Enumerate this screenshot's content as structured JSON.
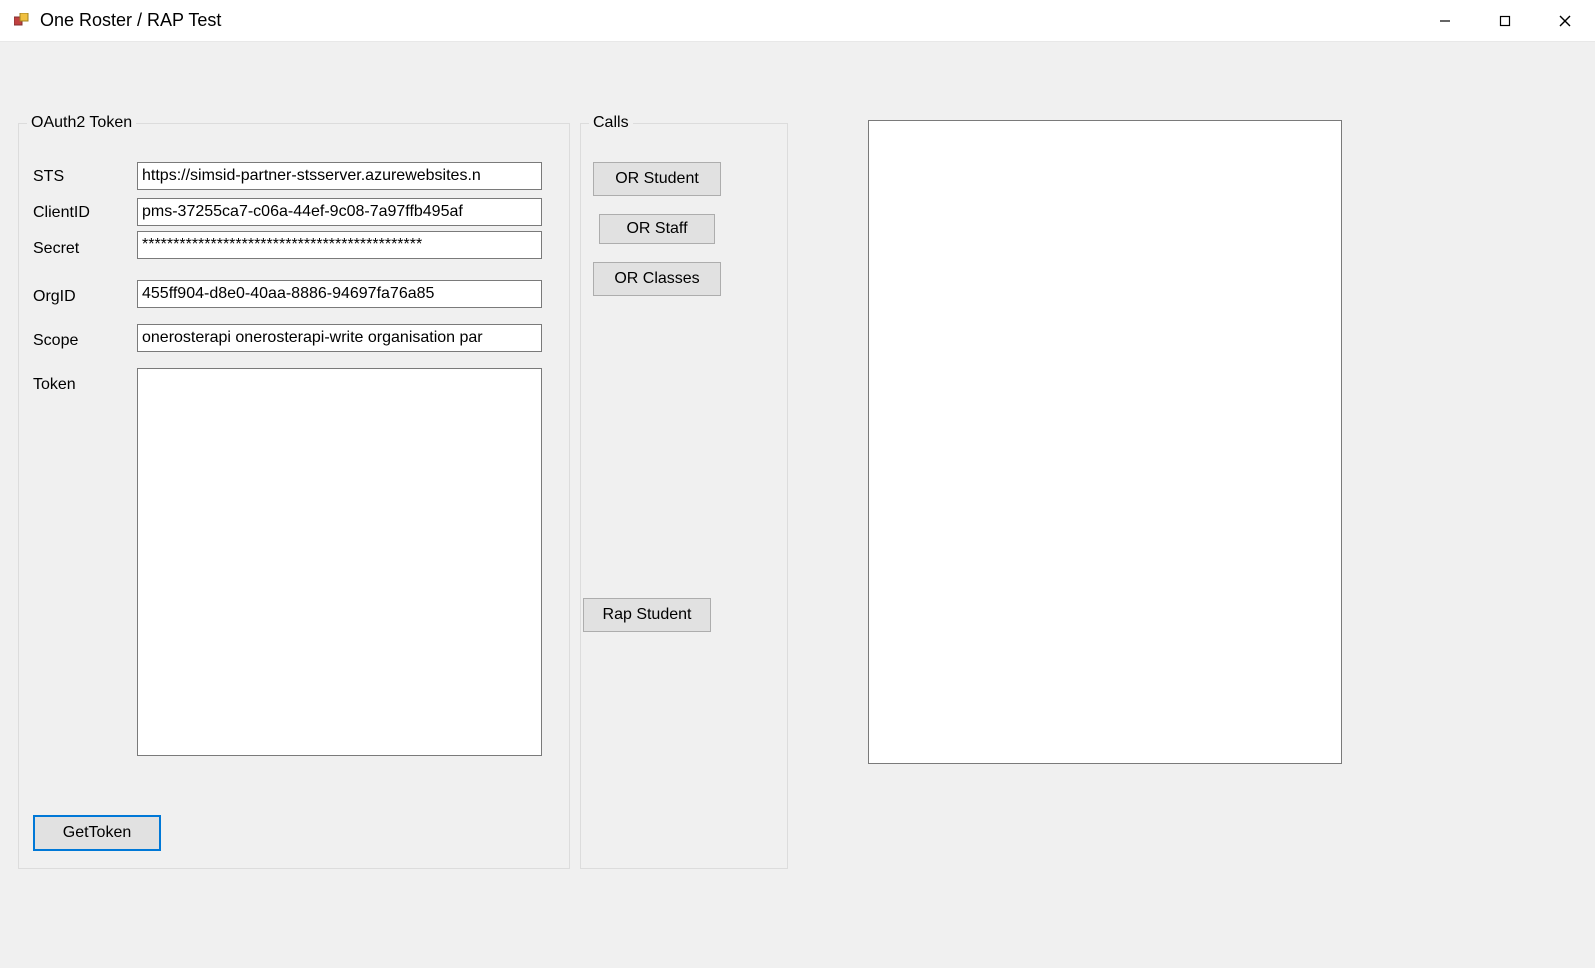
{
  "window": {
    "title": "One Roster / RAP Test"
  },
  "oauth": {
    "legend": "OAuth2 Token",
    "sts_label": "STS",
    "sts_value": "https://simsid-partner-stsserver.azurewebsites.n",
    "clientid_label": "ClientID",
    "clientid_value": "pms-37255ca7-c06a-44ef-9c08-7a97ffb495af",
    "secret_label": "Secret",
    "secret_value": "*********************************************",
    "orgid_label": "OrgID",
    "orgid_value": "455ff904-d8e0-40aa-8886-94697fa76a85",
    "scope_label": "Scope",
    "scope_value": "onerosterapi onerosterapi-write organisation par",
    "token_label": "Token",
    "token_value": "",
    "gettoken_label": "GetToken"
  },
  "calls": {
    "legend": "Calls",
    "or_student_label": "OR Student",
    "or_staff_label": "OR Staff",
    "or_classes_label": "OR Classes",
    "rap_student_label": "Rap Student"
  },
  "output": {
    "text": ""
  }
}
